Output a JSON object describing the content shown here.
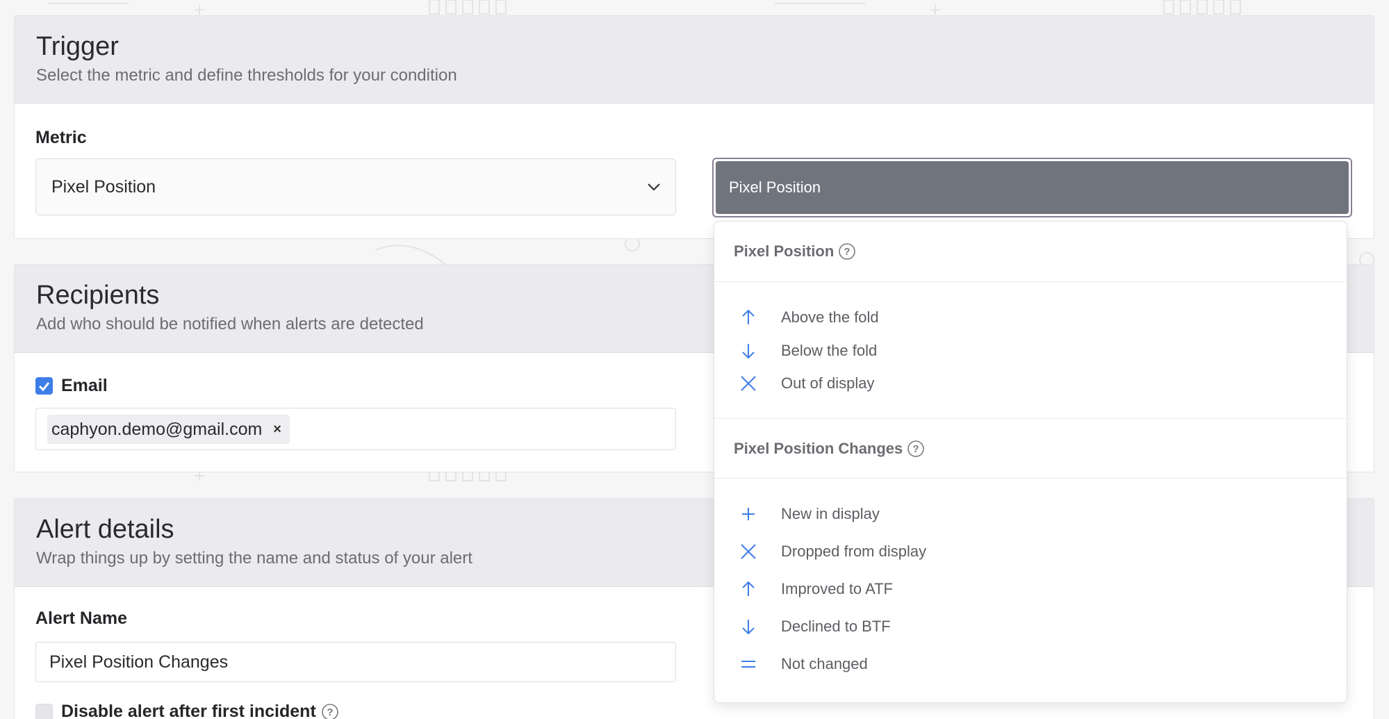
{
  "trigger": {
    "title": "Trigger",
    "subtitle": "Select the metric and define thresholds for your condition",
    "metric_label": "Metric",
    "metric_value": "Pixel Position",
    "condition_value": "Pixel Position"
  },
  "recipients": {
    "title": "Recipients",
    "subtitle": "Add who should be notified when alerts are detected",
    "email_label": "Email",
    "email_checked": true,
    "emails": [
      "caphyon.demo@gmail.com"
    ],
    "remove_symbol": "×"
  },
  "alert": {
    "title": "Alert details",
    "subtitle": "Wrap things up by setting the name and status of your alert",
    "name_label": "Alert Name",
    "name_value": "Pixel Position Changes",
    "disable_label": "Disable alert after first incident",
    "disable_checked": false
  },
  "menu": {
    "groups": [
      {
        "title": "Pixel Position",
        "items": [
          {
            "label": "Above the fold",
            "icon": "arrow-up-icon"
          },
          {
            "label": "Below the fold",
            "icon": "arrow-down-icon"
          },
          {
            "label": "Out of display",
            "icon": "cross-icon"
          }
        ]
      },
      {
        "title": "Pixel Position Changes",
        "items": [
          {
            "label": "New in display",
            "icon": "plus-icon"
          },
          {
            "label": "Dropped from display",
            "icon": "cross-icon"
          },
          {
            "label": "Improved to ATF",
            "icon": "arrow-up-icon"
          },
          {
            "label": "Declined to BTF",
            "icon": "arrow-down-icon"
          },
          {
            "label": "Not changed",
            "icon": "equals-icon"
          }
        ]
      }
    ]
  },
  "colors": {
    "accent": "#3f7de8",
    "selected_bg": "#6f747d",
    "header_bg": "#ebebee"
  }
}
